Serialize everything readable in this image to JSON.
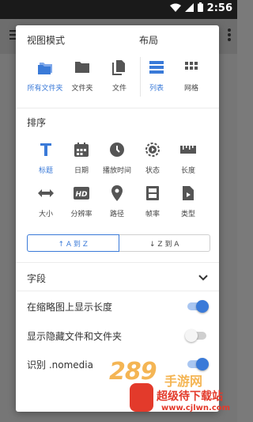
{
  "status_bar": {
    "time": "2:56",
    "icons": [
      "wifi-icon",
      "signal-icon",
      "battery-icon"
    ]
  },
  "view_mode": {
    "title": "视图模式",
    "options": [
      {
        "label": "所有文件夹",
        "icon": "folders-icon",
        "selected": true
      },
      {
        "label": "文件夹",
        "icon": "folder-icon",
        "selected": false
      },
      {
        "label": "文件",
        "icon": "file-icon",
        "selected": false
      }
    ]
  },
  "layout": {
    "title": "布局",
    "options": [
      {
        "label": "列表",
        "icon": "list-icon",
        "selected": true
      },
      {
        "label": "网格",
        "icon": "grid-icon",
        "selected": false
      }
    ]
  },
  "sort": {
    "title": "排序",
    "options": [
      {
        "label": "标题",
        "icon": "title-icon",
        "selected": true
      },
      {
        "label": "日期",
        "icon": "calendar-icon",
        "selected": false
      },
      {
        "label": "播放时间",
        "icon": "clock-icon",
        "selected": false
      },
      {
        "label": "状态",
        "icon": "status-icon",
        "selected": false
      },
      {
        "label": "长度",
        "icon": "ruler-icon",
        "selected": false
      },
      {
        "label": "大小",
        "icon": "size-arrows-icon",
        "selected": false
      },
      {
        "label": "分辨率",
        "icon": "hd-icon",
        "selected": false
      },
      {
        "label": "路径",
        "icon": "location-pin-icon",
        "selected": false
      },
      {
        "label": "帧率",
        "icon": "film-icon",
        "selected": false
      },
      {
        "label": "类型",
        "icon": "file-type-icon",
        "selected": false
      }
    ],
    "order": {
      "asc_label": "↑ A 到 Z",
      "desc_label": "↓ Z 到 A",
      "selected": "asc"
    }
  },
  "fields": {
    "title": "字段",
    "icon": "chevron-down-icon"
  },
  "toggles": [
    {
      "label": "在缩略图上显示长度",
      "on": true
    },
    {
      "label": "显示隐藏文件和文件夹",
      "on": false
    },
    {
      "label": "识别 .nomedia",
      "on": true
    }
  ],
  "watermark": {
    "number": "289",
    "sub": "手游网",
    "name": "超级待下载站",
    "url": "www.cjlwn.com"
  },
  "colors": {
    "accent": "#3a7ad8",
    "icon_gray": "#555555",
    "accent_light": "#a9c6f1"
  }
}
